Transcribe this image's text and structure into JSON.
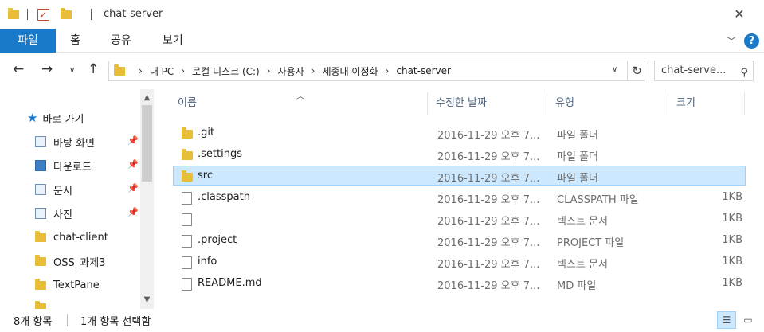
{
  "window": {
    "title": "chat-server",
    "close_glyph": "✕"
  },
  "ribbon": {
    "file_tab": "파일",
    "tabs": [
      "홈",
      "공유",
      "보기"
    ],
    "help": "?"
  },
  "address": {
    "crumbs": [
      "내 PC",
      "로컬 디스크 (C:)",
      "사용자",
      "세종대 이정화",
      "chat-server"
    ],
    "separator": "›"
  },
  "search": {
    "placeholder": "chat-serve..."
  },
  "nav_pane": {
    "quick_access": "바로 가기",
    "items": [
      {
        "label": "바탕 화면",
        "icon": "desktop-icon",
        "pinned": true
      },
      {
        "label": "다운로드",
        "icon": "downloads-icon",
        "pinned": true
      },
      {
        "label": "문서",
        "icon": "documents-icon",
        "pinned": true
      },
      {
        "label": "사진",
        "icon": "pictures-icon",
        "pinned": true
      },
      {
        "label": "chat-client",
        "icon": "folder-icon",
        "pinned": false
      },
      {
        "label": "OSS_과제3",
        "icon": "folder-icon",
        "pinned": false
      },
      {
        "label": "TextPane",
        "icon": "folder-icon",
        "pinned": false
      },
      {
        "label": "...",
        "icon": "folder-icon",
        "pinned": false
      }
    ]
  },
  "file_list": {
    "columns": [
      "이름",
      "수정한 날짜",
      "유형",
      "크기"
    ],
    "rows": [
      {
        "name": ".git",
        "date": "2016-11-29 오후 7...",
        "type": "파일 폴더",
        "size": "",
        "kind": "folder",
        "selected": false
      },
      {
        "name": ".settings",
        "date": "2016-11-29 오후 7...",
        "type": "파일 폴더",
        "size": "",
        "kind": "folder",
        "selected": false
      },
      {
        "name": "src",
        "date": "2016-11-29 오후 7...",
        "type": "파일 폴더",
        "size": "",
        "kind": "folder",
        "selected": true
      },
      {
        "name": ".classpath",
        "date": "2016-11-29 오후 7...",
        "type": "CLASSPATH 파일",
        "size": "1KB",
        "kind": "file",
        "selected": false
      },
      {
        "name": "",
        "date": "2016-11-29 오후 7...",
        "type": "텍스트 문서",
        "size": "1KB",
        "kind": "file",
        "selected": false
      },
      {
        "name": ".project",
        "date": "2016-11-29 오후 7...",
        "type": "PROJECT 파일",
        "size": "1KB",
        "kind": "file",
        "selected": false
      },
      {
        "name": "info",
        "date": "2016-11-29 오후 7...",
        "type": "텍스트 문서",
        "size": "1KB",
        "kind": "file",
        "selected": false
      },
      {
        "name": "README.md",
        "date": "2016-11-29 오후 7...",
        "type": "MD 파일",
        "size": "1KB",
        "kind": "file",
        "selected": false
      }
    ]
  },
  "status": {
    "item_count": "8개 항목",
    "selection": "1개 항목 선택함"
  },
  "colors": {
    "accent": "#1979ca",
    "selection_bg": "#cce8ff",
    "folder": "#e8bd3a"
  }
}
